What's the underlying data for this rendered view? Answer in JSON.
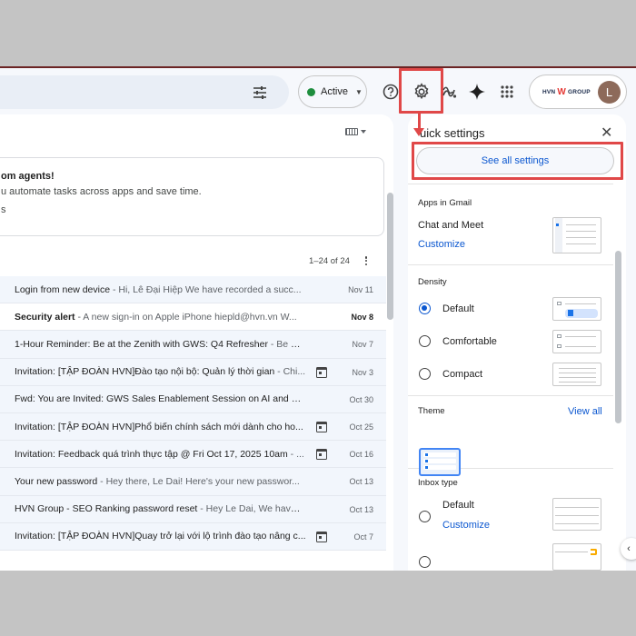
{
  "header": {
    "status_label": "Active",
    "brand": {
      "left": "HVN",
      "mark": "W",
      "right": "GROUP"
    },
    "avatar_initial": "L"
  },
  "main": {
    "promo": {
      "title": "om agents!",
      "subtitle": "u automate tasks across apps and save time.",
      "link": "s"
    },
    "pagination": "1–24 of 24",
    "emails": [
      {
        "subject": "Login from new device",
        "snippet": " - Hi, Lê Đại Hiệp We have recorded a succ...",
        "date": "Nov 11",
        "unread": false,
        "calendar": false
      },
      {
        "subject": "Security alert",
        "snippet": " - A new sign-in on Apple iPhone hiepld@hvn.vn W...",
        "date": "Nov 8",
        "unread": true,
        "calendar": false
      },
      {
        "subject": "1-Hour Reminder: Be at the Zenith with GWS: Q4 Refresher",
        "snippet": " - Be at...",
        "date": "Nov 7",
        "unread": false,
        "calendar": false
      },
      {
        "subject": "Invitation: [TẬP ĐOÀN HVN]Đào tạo nội bộ: Quản lý thời gian",
        "snippet": " - Chi...",
        "date": "Nov 3",
        "unread": false,
        "calendar": true
      },
      {
        "subject": "Fwd: You are Invited: GWS Sales Enablement Session on AI and En...",
        "snippet": "",
        "date": "Oct 30",
        "unread": false,
        "calendar": false
      },
      {
        "subject": "Invitation: [TẬP ĐOÀN HVN]Phổ biến chính sách mới dành cho ho...",
        "snippet": "",
        "date": "Oct 25",
        "unread": false,
        "calendar": true
      },
      {
        "subject": "Invitation: Feedback quá trình thực tập @ Fri Oct 17, 2025 10am",
        "snippet": " - ...",
        "date": "Oct 16",
        "unread": false,
        "calendar": true
      },
      {
        "subject": "Your new password",
        "snippet": " - Hey there, Le Dai! Here's your new passwor...",
        "date": "Oct 13",
        "unread": false,
        "calendar": false
      },
      {
        "subject": "HVN Group - SEO Ranking password reset",
        "snippet": " - Hey Le Dai, We have r...",
        "date": "Oct 13",
        "unread": false,
        "calendar": false
      },
      {
        "subject": "Invitation: [TẬP ĐOÀN HVN]Quay trở lại với lộ trình đào tạo nâng c...",
        "snippet": "",
        "date": "Oct 7",
        "unread": false,
        "calendar": true
      }
    ]
  },
  "quick_settings": {
    "title": "uick settings",
    "see_all": "See all settings",
    "apps_title": "Apps in Gmail",
    "chat_meet": "Chat and Meet",
    "customize": "Customize",
    "density_title": "Density",
    "density_options": [
      "Default",
      "Comfortable",
      "Compact"
    ],
    "theme_title": "Theme",
    "view_all": "View all",
    "inbox_title": "Inbox type",
    "inbox_default": "Default",
    "inbox_customize": "Customize"
  }
}
